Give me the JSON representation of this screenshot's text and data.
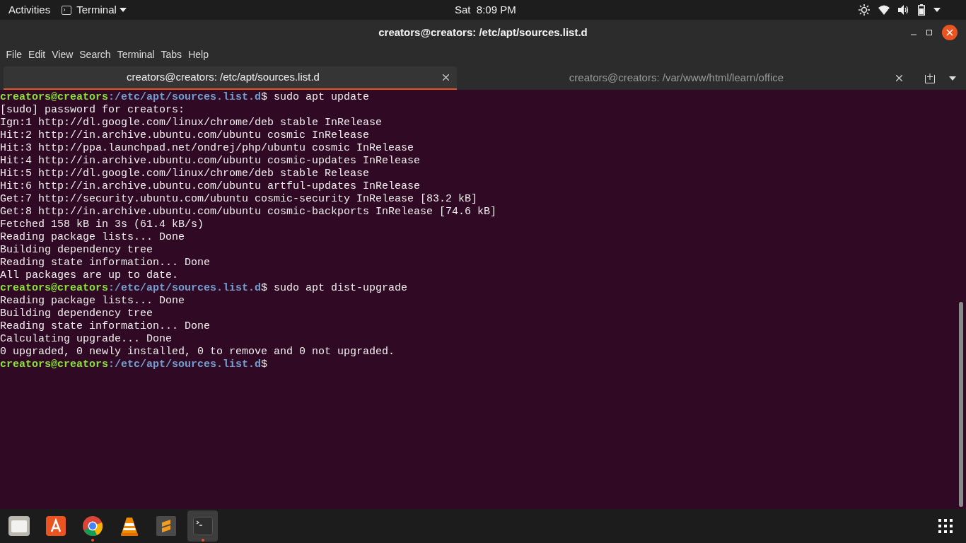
{
  "top_bar": {
    "activities": "Activities",
    "app_menu": "Terminal",
    "clock": "Sat  8:09 PM"
  },
  "window": {
    "title": "creators@creators: /etc/apt/sources.list.d"
  },
  "menu": [
    "File",
    "Edit",
    "View",
    "Search",
    "Terminal",
    "Tabs",
    "Help"
  ],
  "tabs": [
    {
      "label": "creators@creators: /etc/apt/sources.list.d",
      "selected": true
    },
    {
      "label": "creators@creators: /var/www/html/learn/office",
      "selected": false
    }
  ],
  "lines": [
    {
      "kind": "prompt",
      "user": "creators@creators",
      "path": ":/etc/apt/sources.list.d",
      "command": "$ sudo apt update"
    },
    {
      "kind": "output",
      "text": "[sudo] password for creators:"
    },
    {
      "kind": "output",
      "text": "Ign:1 http://dl.google.com/linux/chrome/deb stable InRelease"
    },
    {
      "kind": "output",
      "text": "Hit:2 http://in.archive.ubuntu.com/ubuntu cosmic InRelease"
    },
    {
      "kind": "output",
      "text": "Hit:3 http://ppa.launchpad.net/ondrej/php/ubuntu cosmic InRelease"
    },
    {
      "kind": "output",
      "text": "Hit:4 http://in.archive.ubuntu.com/ubuntu cosmic-updates InRelease"
    },
    {
      "kind": "output",
      "text": "Hit:5 http://dl.google.com/linux/chrome/deb stable Release"
    },
    {
      "kind": "output",
      "text": "Hit:6 http://in.archive.ubuntu.com/ubuntu artful-updates InRelease"
    },
    {
      "kind": "output",
      "text": "Get:7 http://security.ubuntu.com/ubuntu cosmic-security InRelease [83.2 kB]"
    },
    {
      "kind": "output",
      "text": "Get:8 http://in.archive.ubuntu.com/ubuntu cosmic-backports InRelease [74.6 kB]"
    },
    {
      "kind": "output",
      "text": "Fetched 158 kB in 3s (61.4 kB/s)"
    },
    {
      "kind": "output",
      "text": "Reading package lists... Done"
    },
    {
      "kind": "output",
      "text": "Building dependency tree"
    },
    {
      "kind": "output",
      "text": "Reading state information... Done"
    },
    {
      "kind": "output",
      "text": "All packages are up to date."
    },
    {
      "kind": "prompt",
      "user": "creators@creators",
      "path": ":/etc/apt/sources.list.d",
      "command": "$ sudo apt dist-upgrade"
    },
    {
      "kind": "output",
      "text": "Reading package lists... Done"
    },
    {
      "kind": "output",
      "text": "Building dependency tree"
    },
    {
      "kind": "output",
      "text": "Reading state information... Done"
    },
    {
      "kind": "output",
      "text": "Calculating upgrade... Done"
    },
    {
      "kind": "output",
      "text": "0 upgraded, 0 newly installed, 0 to remove and 0 not upgraded."
    },
    {
      "kind": "prompt",
      "user": "creators@creators",
      "path": ":/etc/apt/sources.list.d",
      "command": "$"
    }
  ],
  "dock": [
    {
      "kind": "files",
      "running": false,
      "selected": false
    },
    {
      "kind": "software",
      "running": false,
      "selected": false
    },
    {
      "kind": "chrome",
      "running": true,
      "selected": false
    },
    {
      "kind": "vlc",
      "running": false,
      "selected": false
    },
    {
      "kind": "sublime",
      "running": false,
      "selected": false
    },
    {
      "kind": "terminal",
      "running": true,
      "selected": true
    }
  ]
}
